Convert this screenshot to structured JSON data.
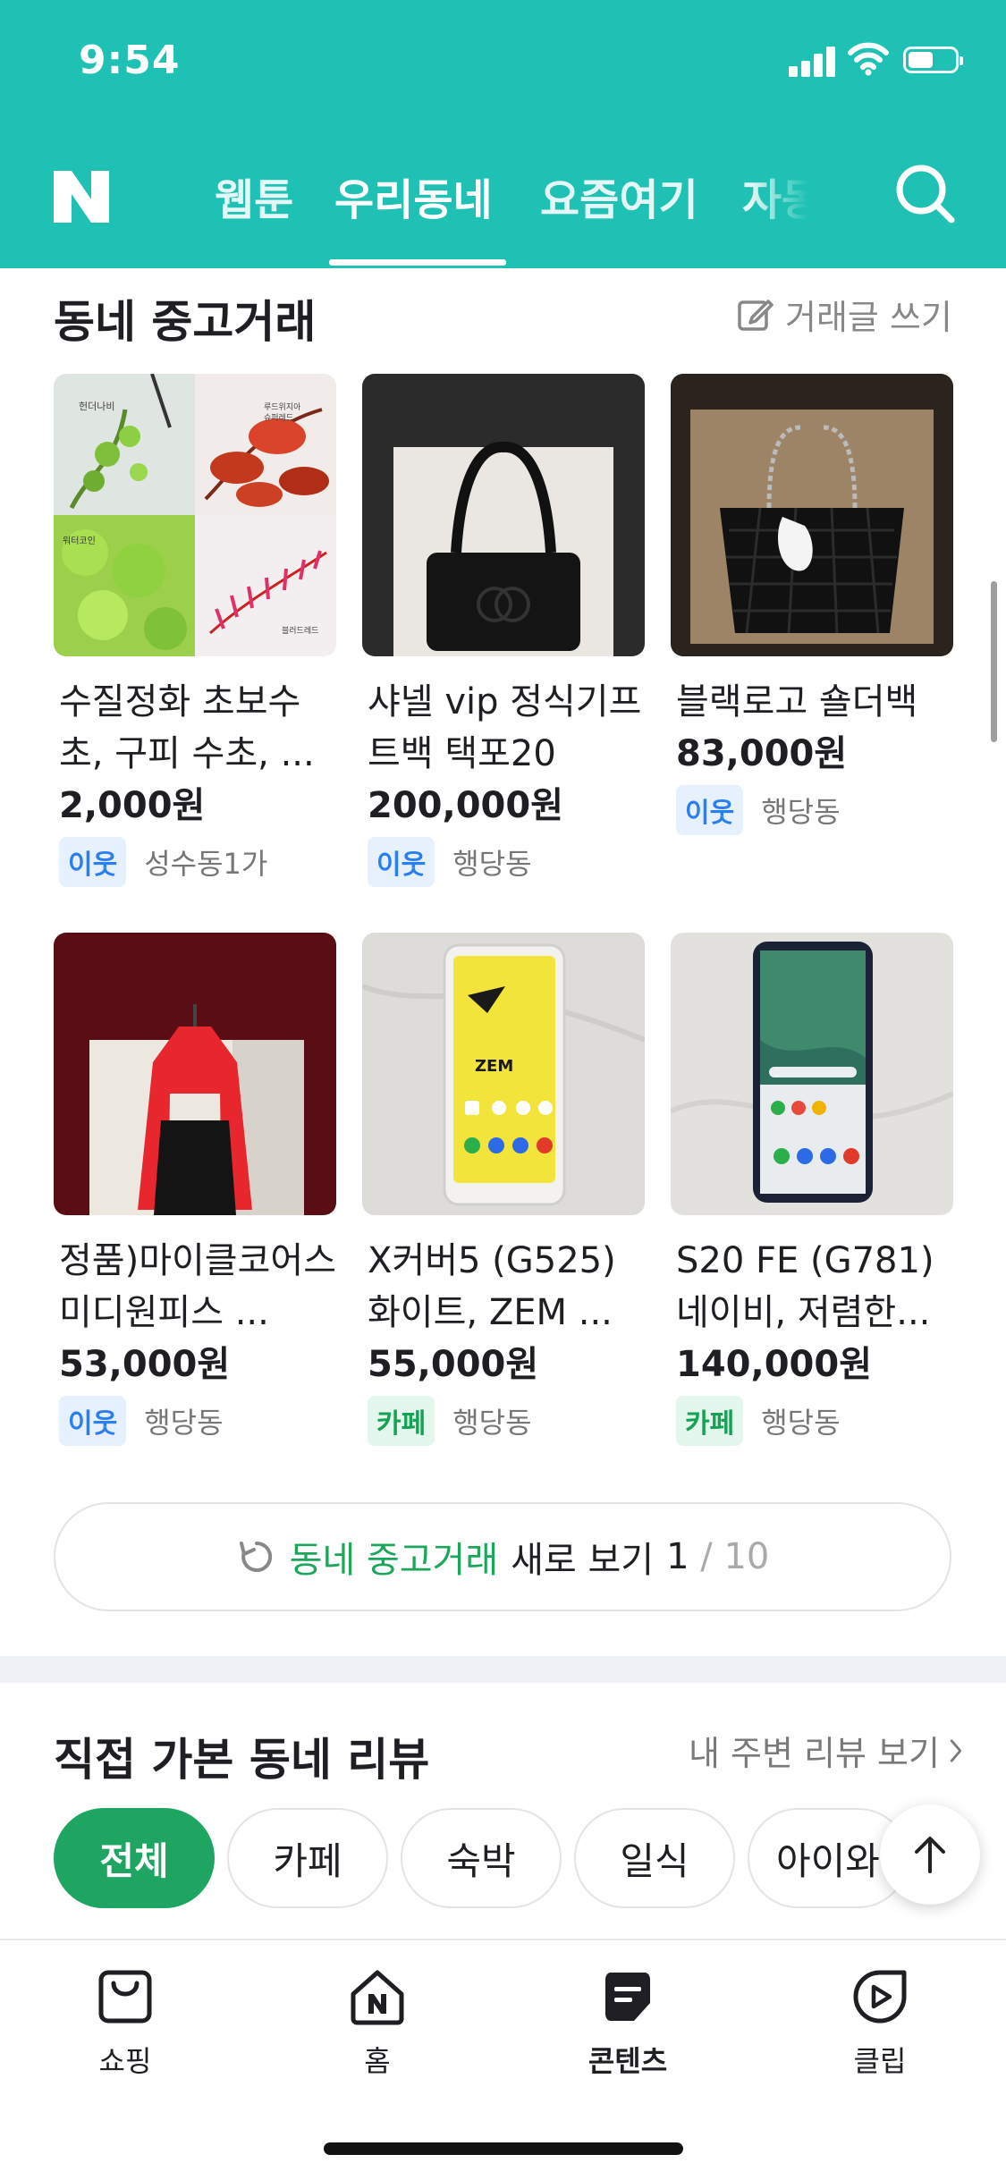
{
  "status": {
    "time": "9:54"
  },
  "header": {
    "tabs": [
      "웹툰",
      "우리동네",
      "요즘여기",
      "자동"
    ],
    "active_tab_index": 1
  },
  "used": {
    "title": "동네 중고거래",
    "write_label": "거래글 쓰기",
    "items": [
      {
        "title": "수질정화 초보수초, 구피 수초, ...",
        "price": "2,000원",
        "badge": "이웃",
        "badge_type": "blue",
        "location": "성수동1가",
        "thumb_labels": [
          "헌더나비",
          "루드위지아 슈퍼레드",
          "워터코인",
          "블러드레드"
        ]
      },
      {
        "title": "샤넬 vip 정식기프트백 택포20",
        "price": "200,000원",
        "badge": "이웃",
        "badge_type": "blue",
        "location": "행당동"
      },
      {
        "title": "블랙로고 숄더백",
        "price": "83,000원",
        "badge": "이웃",
        "badge_type": "blue",
        "location": "행당동"
      },
      {
        "title": "정품)마이클코어스 미디원피스 ...",
        "price": "53,000원",
        "badge": "이웃",
        "badge_type": "blue",
        "location": "행당동"
      },
      {
        "title": "X커버5 (G525) 화이트, ZEM ...",
        "price": "55,000원",
        "badge": "카페",
        "badge_type": "green",
        "location": "행당동",
        "screen_text": "ZEM"
      },
      {
        "title": "S20 FE (G781) 네이비, 저렴한...",
        "price": "140,000원",
        "badge": "카페",
        "badge_type": "green",
        "location": "행당동"
      }
    ],
    "more": {
      "highlight": "동네 중고거래",
      "text": "새로 보기",
      "page_current": "1",
      "page_separator": "/",
      "page_total": "10"
    }
  },
  "reviews": {
    "title": "직접 가본 동네 리뷰",
    "more_label": "내 주변 리뷰 보기",
    "chips": [
      "전체",
      "카페",
      "숙박",
      "일식",
      "아이와"
    ],
    "active_chip_index": 0
  },
  "bottom_nav": [
    {
      "label": "쇼핑",
      "icon": "shopping-bag-icon"
    },
    {
      "label": "홈",
      "icon": "home-icon"
    },
    {
      "label": "콘텐츠",
      "icon": "contents-icon"
    },
    {
      "label": "클립",
      "icon": "clip-icon"
    }
  ],
  "colors": {
    "brand": "#1ec1b3",
    "accent_green": "#1ea562",
    "badge_blue": "#2a7ff2"
  }
}
